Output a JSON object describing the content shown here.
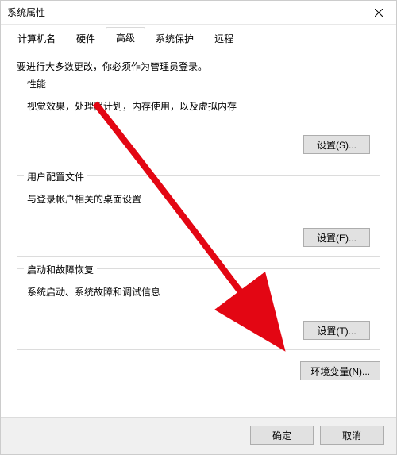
{
  "window": {
    "title": "系统属性"
  },
  "tabs": {
    "computer_name": "计算机名",
    "hardware": "硬件",
    "advanced": "高级",
    "system_protection": "系统保护",
    "remote": "远程"
  },
  "content": {
    "intro": "要进行大多数更改，你必须作为管理员登录。"
  },
  "performance": {
    "title": "性能",
    "desc": "视觉效果，处理器计划，内存使用，以及虚拟内存",
    "button": "设置(S)..."
  },
  "user_profiles": {
    "title": "用户配置文件",
    "desc": "与登录帐户相关的桌面设置",
    "button": "设置(E)..."
  },
  "startup_recovery": {
    "title": "启动和故障恢复",
    "desc": "系统启动、系统故障和调试信息",
    "button": "设置(T)..."
  },
  "env": {
    "button": "环境变量(N)..."
  },
  "footer": {
    "ok": "确定",
    "cancel": "取消"
  }
}
